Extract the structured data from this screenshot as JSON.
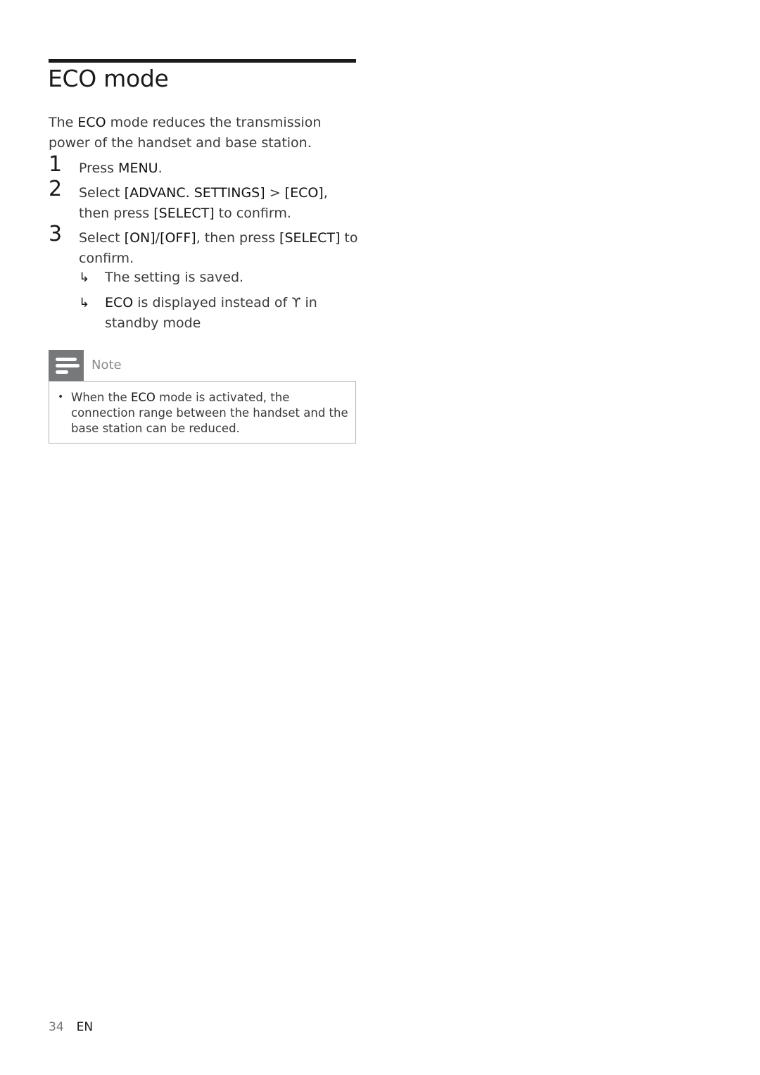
{
  "section": {
    "title": "ECO mode",
    "intro": {
      "pre": "The ",
      "bold": "ECO",
      "post": " mode reduces the transmission power of the handset and base station."
    }
  },
  "steps": [
    {
      "number": "1",
      "parts": [
        "Press ",
        "MENU",
        "."
      ]
    },
    {
      "number": "2",
      "parts": [
        "Select ",
        "[ADVANC. SETTINGS]",
        " > ",
        "[ECO]",
        ", then press ",
        "[SELECT]",
        " to confirm."
      ]
    },
    {
      "number": "3",
      "parts": [
        "Select ",
        "[ON]",
        "/",
        "[OFF]",
        ", then press ",
        "[SELECT]",
        " to confirm."
      ]
    }
  ],
  "results": [
    {
      "arrow": "↳",
      "pre": "",
      "bold": "",
      "text": "The setting is saved."
    },
    {
      "arrow": "↳",
      "bold": "ECO",
      "text": " is displayed instead of ϒ in standby mode"
    }
  ],
  "note": {
    "label": "Note",
    "icon": "note-lines-icon",
    "bullet": "•",
    "pre": "When the ",
    "bold": "ECO",
    "post": " mode is activated, the connection range between the handset and the base station can be reduced."
  },
  "footer": {
    "page_number": "34",
    "language": "EN"
  }
}
